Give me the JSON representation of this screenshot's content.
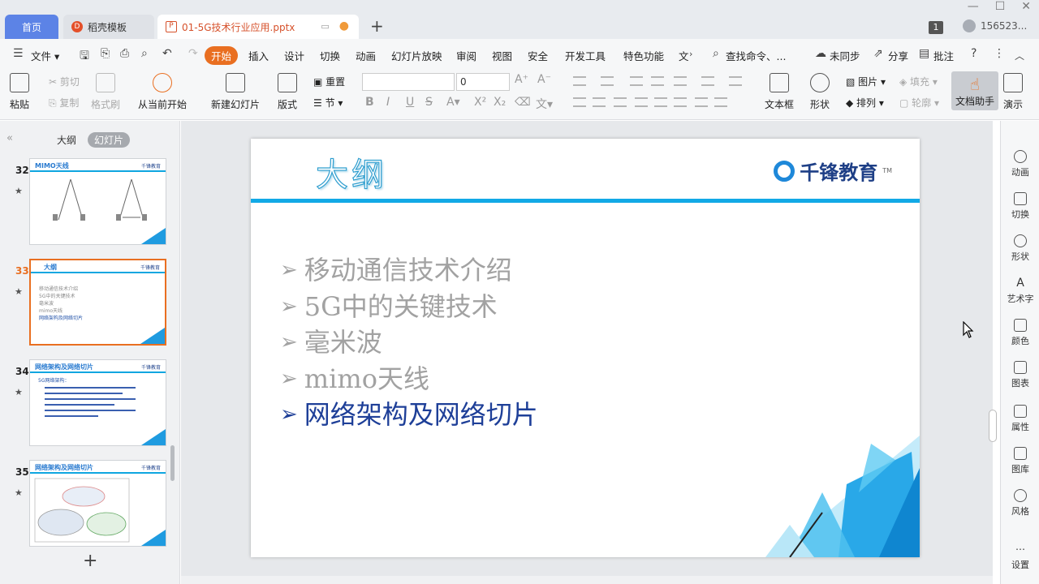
{
  "tabs": {
    "home": "首页",
    "daoke": "稻壳模板",
    "file": "01-5G技术行业应用.pptx",
    "new_tab": "+"
  },
  "titlebar": {
    "badge": "1",
    "user": "156523..."
  },
  "menu": {
    "file": "文件",
    "items": [
      "开始",
      "插入",
      "设计",
      "切换",
      "动画",
      "幻灯片放映",
      "审阅",
      "视图",
      "安全",
      "开发工具",
      "特色功能",
      "文"
    ],
    "search": "查找命令、...",
    "sync": "未同步",
    "share": "分享",
    "comment": "批注"
  },
  "ribbon": {
    "paste": "粘贴",
    "cut": "剪切",
    "copy": "复制",
    "format_painter": "格式刷",
    "from_current": "从当前开始",
    "new_slide": "新建幻灯片",
    "layout": "版式",
    "reset": "重置",
    "section": "节",
    "font_size": "0",
    "textbox": "文本框",
    "shape": "形状",
    "picture": "图片",
    "fill": "填充",
    "arrange": "排列",
    "outline": "轮廓",
    "doc_helper": "文档助手",
    "present": "演示"
  },
  "left_panel": {
    "tab_outline": "大纲",
    "tab_slides": "幻灯片",
    "slides": [
      {
        "num": "32",
        "title": "MIMO天线"
      },
      {
        "num": "33",
        "title": "大纲",
        "lines": [
          "移动通信技术介绍",
          "5G中的关键技术",
          "毫米波",
          "mimo天线",
          "网络架构及网络切片"
        ]
      },
      {
        "num": "34",
        "title": "网络架构及网络切片",
        "lines": [
          "5G网络架构："
        ]
      },
      {
        "num": "35",
        "title": "网络架构及网络切片"
      }
    ],
    "logo": "千锋教育"
  },
  "slide": {
    "title": "大纲",
    "logo": "千锋教育",
    "logo_tm": "TM",
    "bullets": [
      "移动通信技术介绍",
      "5G中的关键技术",
      "毫米波",
      "mimo天线",
      "网络架构及网络切片"
    ],
    "current_index": 4
  },
  "right_sidebar": [
    "动画",
    "切换",
    "形状",
    "艺术字",
    "颜色",
    "图表",
    "属性",
    "图库",
    "风格",
    "设置"
  ],
  "colors": {
    "accent_orange": "#e96f21",
    "tab_blue": "#5c83e6",
    "slide_blue": "#12a9e6",
    "bullet_active": "#1e3f98",
    "bullet_inactive": "#a2a2a2"
  }
}
